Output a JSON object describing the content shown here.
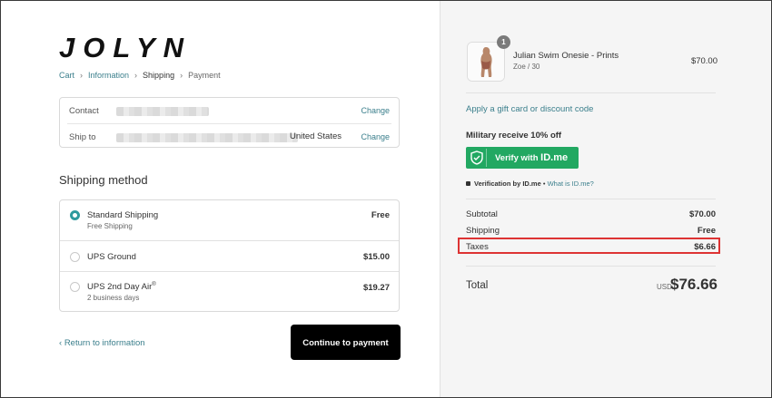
{
  "brand": {
    "logo": "JOLYN"
  },
  "breadcrumbs": [
    {
      "label": "Cart"
    },
    {
      "label": "Information"
    },
    {
      "label": "Shipping"
    },
    {
      "label": "Payment"
    }
  ],
  "contact_box": {
    "contact_label": "Contact",
    "ship_to_label": "Ship to",
    "ship_to_country": "United States",
    "change_label": "Change"
  },
  "shipping": {
    "title": "Shipping method",
    "options": [
      {
        "name": "Standard Shipping",
        "sub": "Free Shipping",
        "price": "Free",
        "selected": true
      },
      {
        "name": "UPS Ground",
        "sub": "",
        "price": "$15.00",
        "selected": false
      },
      {
        "name": "UPS 2nd Day Air",
        "sup": "®",
        "sub": "2 business days",
        "price": "$19.27",
        "selected": false
      }
    ]
  },
  "footer": {
    "back_label": "Return to information",
    "continue_label": "Continue to payment"
  },
  "order": {
    "quantity": "1",
    "product_name": "Julian Swim Onesie - Prints",
    "variant": "Zoe / 30",
    "price": "$70.00",
    "gift_link": "Apply a gift card or discount code",
    "military_title": "Military receive 10% off",
    "idme_prefix": "Verify with",
    "idme_brand": "ID.me",
    "verification_by": "Verification by ID.me",
    "what_is": "What is ID.me?",
    "subtotal_label": "Subtotal",
    "subtotal": "$70.00",
    "shipping_label": "Shipping",
    "shipping": "Free",
    "taxes_label": "Taxes",
    "taxes": "$6.66",
    "total_label": "Total",
    "currency": "USD",
    "total": "$76.66"
  },
  "colors": {
    "accent": "#3b7f8c",
    "radio_selected": "#2f9a9e",
    "idme_green": "#22a862",
    "highlight_red": "#dd3333",
    "button_black": "#000000"
  },
  "icons": [
    "chevron-right-icon",
    "shield-check-icon",
    "lock-icon",
    "chevron-left-icon"
  ]
}
